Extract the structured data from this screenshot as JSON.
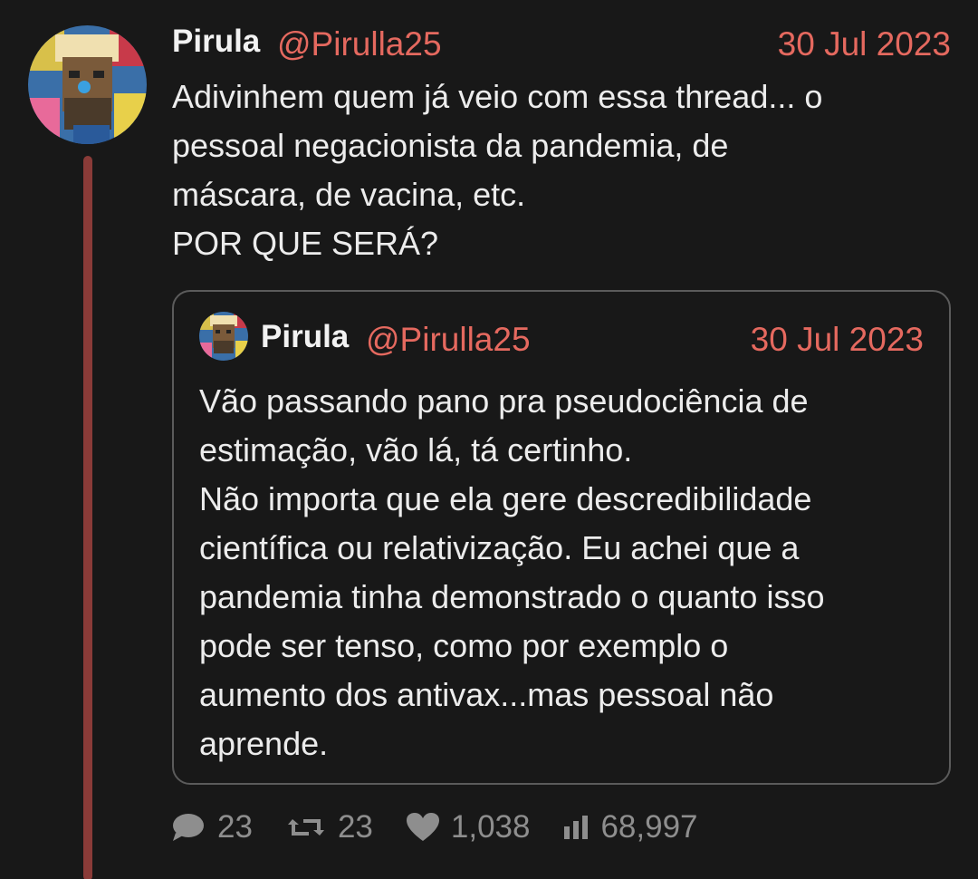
{
  "tweet": {
    "author_name": "Pirula",
    "handle": "@Pirulla25",
    "date": "30 Jul 2023",
    "text": "Adivinhem quem já veio com essa thread... o\npessoal negacionista da pandemia, de\nmáscara, de vacina, etc.\nPOR QUE SERÁ?"
  },
  "quote": {
    "author_name": "Pirula",
    "handle": "@Pirulla25",
    "date": "30 Jul 2023",
    "text": "Vão passando pano pra pseudociência de\nestimação, vão lá, tá certinho.\nNão importa que ela gere descredibilidade\ncientífica ou relativização. Eu achei que a\npandemia tinha demonstrado o quanto isso\npode ser tenso, como por exemplo o\naumento dos antivax...mas pessoal não\naprende."
  },
  "stats": {
    "replies": "23",
    "retweets": "23",
    "likes": "1,038",
    "views": "68,997"
  },
  "icons": {
    "reply": "speech-bubble-icon",
    "retweet": "retweet-arrows-icon",
    "like": "heart-icon",
    "views": "bar-chart-icon"
  },
  "colors": {
    "background": "#181818",
    "accent": "#e5695f",
    "thread_line": "#8a3b38",
    "muted": "#8e8e8e"
  }
}
